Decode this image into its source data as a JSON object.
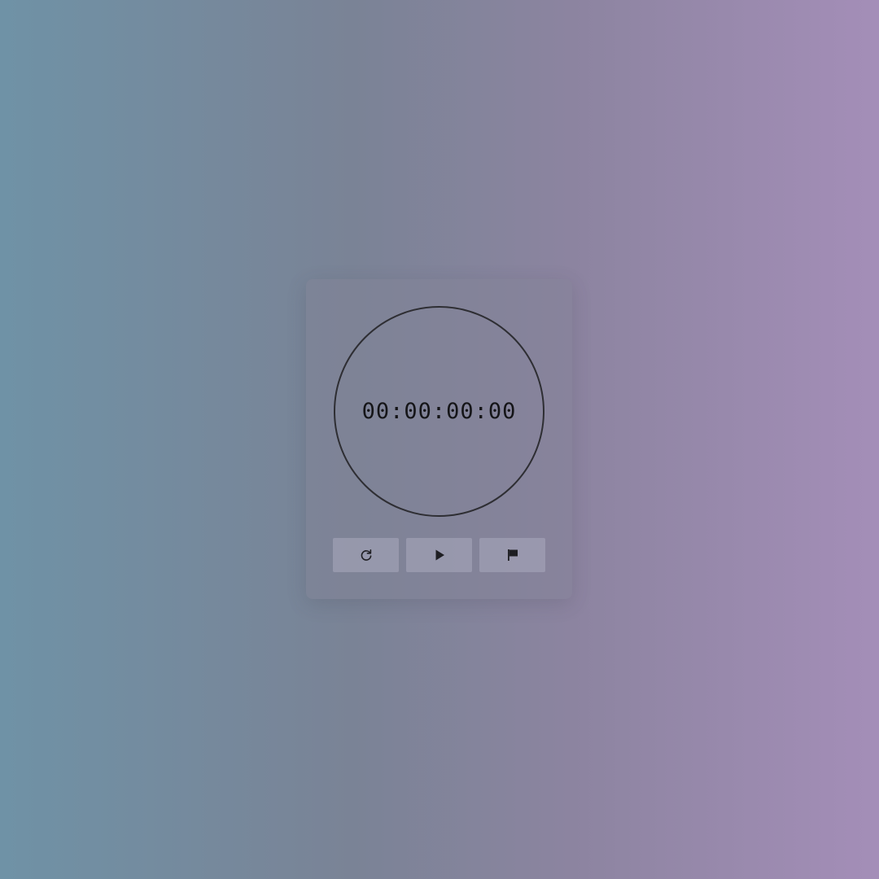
{
  "stopwatch": {
    "display": "00:00:00:00"
  },
  "controls": {
    "reset": {
      "icon": "refresh-icon"
    },
    "start": {
      "icon": "play-icon"
    },
    "lap": {
      "icon": "flag-icon"
    }
  },
  "colors": {
    "background_left": "#6f92a6",
    "background_right": "#a48eb8",
    "dial_stroke": "#2e2e33",
    "text": "#151518"
  }
}
